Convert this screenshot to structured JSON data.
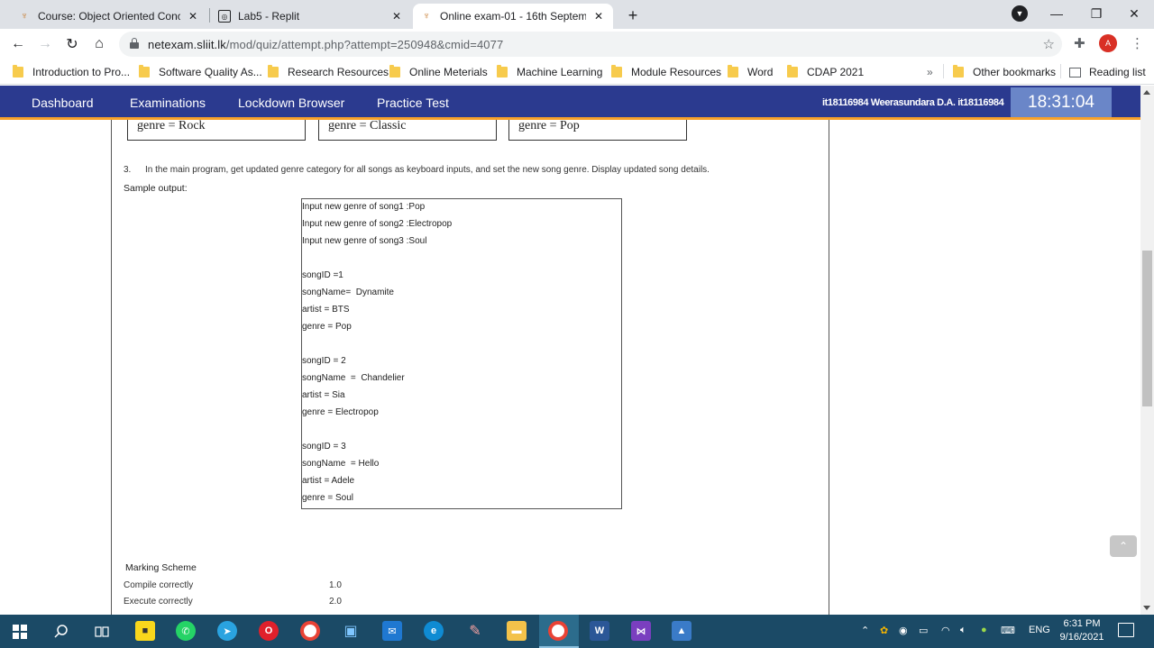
{
  "browser": {
    "tabs": [
      {
        "label": "Course: Object Oriented Concept",
        "icon": "moodle-icon"
      },
      {
        "label": "Lab5 - Replit",
        "icon": "replit-icon"
      },
      {
        "label": "Online exam-01 - 16th Septembe",
        "icon": "moodle-icon",
        "active": true
      }
    ],
    "url_host": "netexam.sliit.lk",
    "url_path": "/mod/quiz/attempt.php?attempt=250948&cmid=4077",
    "bookmarks": [
      "Introduction to Pro...",
      "Software Quality As...",
      "Research Resources",
      "Online Meterials",
      "Machine Learning",
      "Module Resources",
      "Word",
      "CDAP 2021"
    ],
    "overflow": "»",
    "other_bookmarks": "Other bookmarks",
    "reading_list": "Reading list"
  },
  "sitenav": {
    "links": [
      "Dashboard",
      "Examinations",
      "Lockdown Browser",
      "Practice Test"
    ],
    "user": "it18116984 Weerasundara D.A. it18116984",
    "timer": "18:31:04"
  },
  "content": {
    "genre_boxes": [
      "genre = Rock",
      "genre = Classic",
      "genre = Pop"
    ],
    "q3_number": "3.",
    "q3_text": "In the main program, get updated genre category for all songs as keyboard inputs, and set the new song genre. Display updated song details.",
    "sample_label": "Sample output:",
    "output_lines": [
      "Input new genre of song1 :Pop",
      "Input new genre of song2 :Electropop",
      "Input new genre of song3 :Soul",
      "",
      "songID =1",
      "songName=  Dynamite",
      "artist = BTS",
      "genre = Pop",
      "",
      "songID = 2",
      "songName  =  Chandelier",
      "artist = Sia",
      "genre = Electropop",
      "",
      "songID = 3",
      "songName  = Hello",
      "artist = Adele",
      "genre = Soul"
    ],
    "marking_title": "Marking Scheme",
    "marking": [
      {
        "label": "Compile correctly",
        "value": "1.0"
      },
      {
        "label": "Execute correctly",
        "value": "2.0"
      }
    ]
  },
  "taskbar": {
    "lang": "ENG",
    "time": "6:31 PM",
    "date": "9/16/2021"
  }
}
